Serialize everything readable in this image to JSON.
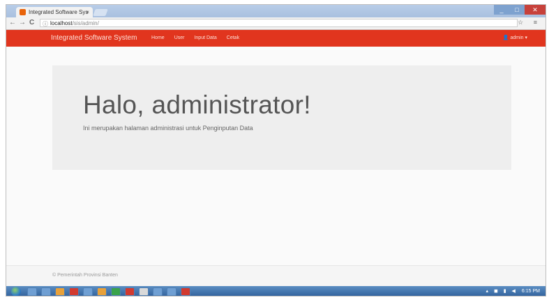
{
  "browser": {
    "tab_title": "Integrated Software Sys",
    "tab_close": "×",
    "url_host": "localhost",
    "url_path": "/sis/admin/",
    "controls": {
      "back": "←",
      "forward": "→",
      "reload": "C"
    },
    "right_icons": "☆ ≡"
  },
  "navbar": {
    "brand": "Integrated Software System",
    "items": [
      {
        "label": "Home"
      },
      {
        "label": "User"
      },
      {
        "label": "Input Data"
      },
      {
        "label": "Cetak"
      }
    ],
    "user_menu": "admin ▾"
  },
  "main": {
    "heading": "Halo, administrator!",
    "subtitle": "Ini merupakan halaman administrasi untuk Penginputan Data"
  },
  "footer": {
    "text": "© Pemerintah Provinsi Banten"
  },
  "taskbar": {
    "tray_icons": "▴ ◼ ▮ ◀",
    "clock": "6:15 PM"
  },
  "colors": {
    "navbar_bg": "#e1351e",
    "jumbotron_bg": "#eeeeee"
  }
}
